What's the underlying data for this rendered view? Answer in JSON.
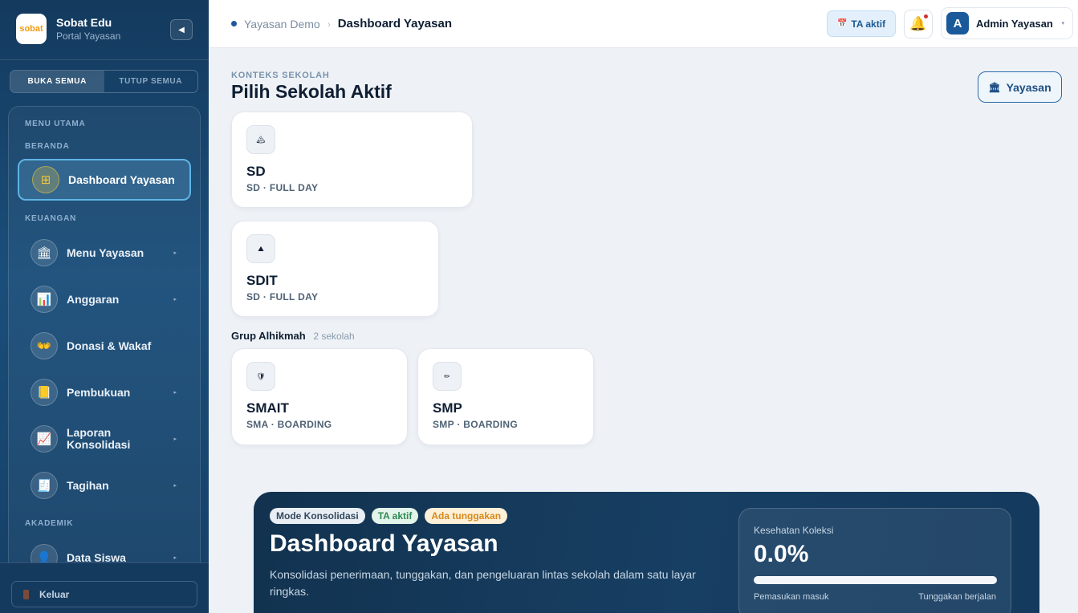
{
  "app": {
    "logo_text": "sobat",
    "name": "Sobat Edu",
    "subtitle": "Portal Yayasan",
    "collapse_icon": "◀"
  },
  "sidebar": {
    "expand_all": "BUKA SEMUA",
    "collapse_all": "TUTUP SEMUA",
    "sections": {
      "main_menu": "MENU UTAMA",
      "home": "BERANDA",
      "finance": "KEUANGAN",
      "academic": "AKADEMIK"
    },
    "items": [
      {
        "label": "Dashboard Yayasan",
        "icon": "⊞",
        "icon_name": "grid-icon",
        "active": true,
        "has_children": false
      },
      {
        "label": "Menu Yayasan",
        "icon": "🏛",
        "icon_name": "institution-icon",
        "active": false,
        "has_children": true
      },
      {
        "label": "Anggaran",
        "icon": "📊",
        "icon_name": "bar-chart-icon",
        "active": false,
        "has_children": true
      },
      {
        "label": "Donasi & Wakaf",
        "icon": "👐",
        "icon_name": "donation-hands-icon",
        "active": false,
        "has_children": false
      },
      {
        "label": "Pembukuan",
        "icon": "📒",
        "icon_name": "ledger-icon",
        "active": false,
        "has_children": true
      },
      {
        "label": "Laporan Konsolidasi",
        "icon": "📈",
        "icon_name": "line-chart-icon",
        "active": false,
        "has_children": true
      },
      {
        "label": "Tagihan",
        "icon": "🧾",
        "icon_name": "invoice-icon",
        "active": false,
        "has_children": true
      },
      {
        "label": "Data Siswa",
        "icon": "👤",
        "icon_name": "student-icon",
        "active": false,
        "has_children": true
      }
    ],
    "chevron": "▸",
    "logout": "Keluar"
  },
  "topbar": {
    "breadcrumb_root": "Yayasan Demo",
    "breadcrumb_sep": "›",
    "breadcrumb_current": "Dashboard Yayasan",
    "ta_badge": "TA aktif",
    "ta_icon": "📅",
    "bell_icon": "🔔",
    "avatar_letter": "A",
    "user_name": "Admin Yayasan",
    "user_chevron": "▾"
  },
  "context": {
    "kicker": "KONTEKS SEKOLAH",
    "title": "Pilih Sekolah Aktif",
    "yayasan_button": "Yayasan",
    "yayasan_icon": "🏛"
  },
  "schools": [
    {
      "name": "SD",
      "meta": "SD · FULL DAY",
      "logo": "🏔"
    },
    {
      "name": "SDIT",
      "meta": "SD · FULL DAY",
      "logo": "⛰"
    }
  ],
  "group": {
    "name": "Grup Alhikmah",
    "count": "2 sekolah",
    "schools": [
      {
        "name": "SMAIT",
        "meta": "SMA · BOARDING",
        "logo": "🛡"
      },
      {
        "name": "SMP",
        "meta": "SMP · BOARDING",
        "logo": "✏"
      }
    ]
  },
  "hero": {
    "chips": {
      "mode": "Mode Konsolidasi",
      "ta": "TA aktif",
      "due": "Ada tunggakan"
    },
    "title": "Dashboard Yayasan",
    "description": "Konsolidasi penerimaan, tunggakan, dan pengeluaran lintas sekolah dalam satu layar ringkas.",
    "health": {
      "label": "Kesehatan Koleksi",
      "value": "0.0%",
      "progress": 0.0,
      "left_label": "Pemasukan masuk",
      "right_label": "Tunggakan berjalan"
    }
  },
  "colors": {
    "sidebar": "#143a5e",
    "accent": "#1a5a9a",
    "active_border": "#5fb3e6",
    "hero": "#12324f",
    "chip_ok": "#2f8a55",
    "chip_warn": "#d68a1a"
  }
}
